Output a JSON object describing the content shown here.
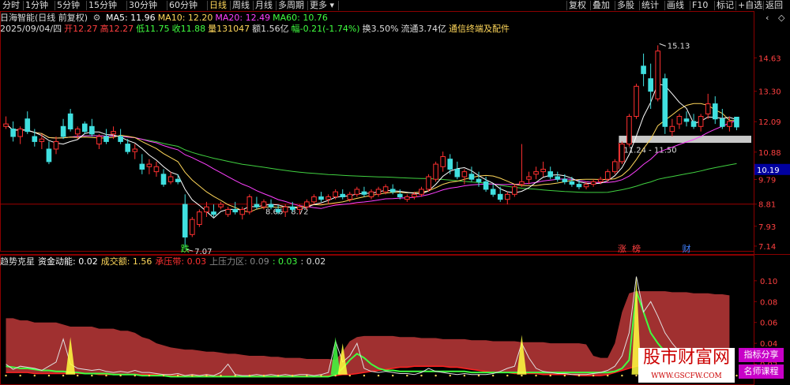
{
  "toolbar": {
    "items": [
      "分时",
      "1分钟",
      "5分钟",
      "15分钟",
      "30分钟",
      "60分钟",
      "日线",
      "周线",
      "月线",
      "多周期",
      "更多"
    ],
    "active": "日线",
    "right_items": [
      "复权",
      "叠加",
      "多股",
      "统计",
      "画线",
      "F10",
      "标记",
      "+自选",
      "返回"
    ],
    "window_icons": [
      "‹",
      "◇"
    ]
  },
  "header": {
    "title": "日海智能(日线 前复权)",
    "ma": [
      {
        "label": "MA5: 11.96",
        "color": "#ffffff"
      },
      {
        "label": "MA10: 12.20",
        "color": "#ffd75a"
      },
      {
        "label": "MA20: 12.49",
        "color": "#ff40ff"
      },
      {
        "label": "MA60: 10.76",
        "color": "#40ff40"
      }
    ],
    "quote": [
      {
        "label": "2025/09/04/四",
        "color": "#dddddd"
      },
      {
        "label": "开12.27",
        "color": "#ff4040"
      },
      {
        "label": "高12.27",
        "color": "#ff4040"
      },
      {
        "label": "低11.75",
        "color": "#40ff40"
      },
      {
        "label": "收11.88",
        "color": "#40ff40"
      },
      {
        "label": "量131047",
        "color": "#ffd75a"
      },
      {
        "label": "额1.56亿",
        "color": "#dddddd"
      },
      {
        "label": "幅-0.21(-1.74%)",
        "color": "#40ff40"
      },
      {
        "label": "换3.50%",
        "color": "#dddddd"
      },
      {
        "label": "流通3.74亿",
        "color": "#dddddd"
      },
      {
        "label": "通信终端及配件",
        "color": "#ffd75a"
      }
    ]
  },
  "sub_header": [
    {
      "label": "趋势克星",
      "color": "#dddddd"
    },
    {
      "label": "资金动能: 0.02",
      "color": "#ffffff"
    },
    {
      "label": "成交额: 1.56",
      "color": "#ffd75a"
    },
    {
      "label": "承压带: 0.03",
      "color": "#ff3030"
    },
    {
      "label": "上压力区: 0.09",
      "color": "#888888"
    },
    {
      "label": ": 0.03",
      "color": "#40ff40"
    },
    {
      "label": ": 0.02",
      "color": "#dddddd"
    }
  ],
  "chart_data": {
    "type": "candlestick",
    "y_axis_ticks": [
      14.63,
      13.3,
      12.09,
      10.88,
      9.79,
      8.81,
      7.93,
      7.14
    ],
    "ylim": [
      6.95,
      15.55
    ],
    "current_price_label": "10.19",
    "current_price": 10.19,
    "annotations": [
      {
        "text": "15.13",
        "kind": "high"
      },
      {
        "text": "7.07",
        "kind": "low"
      },
      {
        "text": "11.24 - 11.50",
        "kind": "zone",
        "y1": 11.24,
        "y2": 11.5
      },
      {
        "text": "8.66 - 8.72",
        "kind": "zone",
        "y1": 8.66,
        "y2": 8.72
      }
    ],
    "markers": [
      {
        "text": "跌",
        "color": "#40ff40",
        "index": 25
      },
      {
        "text": "涨",
        "color": "#ff4040",
        "index": 86
      },
      {
        "text": "榜",
        "color": "#ff4040",
        "index": 88
      },
      {
        "text": "财",
        "color": "#4080ff",
        "index": 95
      }
    ],
    "candles": [
      [
        11.9,
        12.3,
        11.8,
        12.0
      ],
      [
        11.8,
        12.1,
        11.3,
        11.5
      ],
      [
        11.5,
        11.9,
        11.2,
        11.8
      ],
      [
        12.2,
        12.5,
        11.6,
        11.7
      ],
      [
        11.5,
        11.8,
        11.1,
        11.3
      ],
      [
        11.3,
        11.6,
        11.0,
        11.4
      ],
      [
        11.0,
        11.3,
        10.4,
        10.5
      ],
      [
        11.0,
        11.5,
        10.8,
        11.3
      ],
      [
        11.9,
        12.2,
        11.4,
        11.5
      ],
      [
        12.4,
        12.6,
        11.7,
        11.8
      ],
      [
        11.6,
        11.9,
        11.4,
        11.8
      ],
      [
        12.0,
        12.1,
        11.6,
        11.7
      ],
      [
        11.9,
        12.2,
        11.5,
        11.6
      ],
      [
        11.2,
        11.6,
        11.0,
        11.5
      ],
      [
        11.5,
        11.8,
        11.2,
        11.3
      ],
      [
        11.6,
        11.9,
        11.4,
        11.7
      ],
      [
        11.5,
        11.8,
        11.2,
        11.3
      ],
      [
        11.2,
        11.4,
        10.8,
        10.9
      ],
      [
        10.9,
        11.2,
        10.6,
        11.0
      ],
      [
        10.4,
        10.8,
        10.0,
        10.2
      ],
      [
        10.3,
        10.6,
        10.0,
        10.4
      ],
      [
        10.1,
        10.5,
        9.9,
        10.3
      ],
      [
        10.0,
        10.2,
        9.5,
        9.6
      ],
      [
        9.7,
        10.1,
        9.6,
        9.9
      ],
      [
        9.8,
        10.0,
        9.6,
        9.7
      ],
      [
        8.8,
        9.2,
        7.07,
        7.5
      ],
      [
        7.6,
        8.3,
        7.5,
        8.2
      ],
      [
        8.0,
        8.6,
        7.9,
        8.5
      ],
      [
        8.5,
        8.9,
        8.3,
        8.7
      ],
      [
        8.5,
        8.8,
        8.3,
        8.4
      ],
      [
        8.7,
        8.9,
        8.6,
        8.8
      ],
      [
        8.4,
        8.7,
        8.3,
        8.6
      ],
      [
        8.6,
        8.9,
        8.4,
        8.5
      ],
      [
        8.4,
        8.7,
        8.2,
        8.6
      ],
      [
        8.5,
        9.2,
        8.4,
        9.1
      ],
      [
        8.8,
        9.1,
        8.6,
        8.7
      ],
      [
        8.7,
        9.0,
        8.6,
        8.9
      ],
      [
        8.8,
        9.0,
        8.6,
        8.7
      ],
      [
        8.6,
        8.8,
        8.4,
        8.5
      ],
      [
        8.5,
        8.8,
        8.3,
        8.7
      ],
      [
        8.7,
        8.9,
        8.5,
        8.6
      ],
      [
        8.6,
        8.8,
        8.4,
        8.7
      ],
      [
        8.7,
        9.0,
        8.6,
        8.9
      ],
      [
        8.9,
        9.2,
        8.8,
        9.1
      ],
      [
        9.1,
        9.3,
        8.9,
        9.0
      ],
      [
        9.0,
        9.2,
        8.8,
        9.1
      ],
      [
        9.1,
        9.4,
        9.0,
        9.3
      ],
      [
        9.2,
        9.4,
        9.0,
        9.1
      ],
      [
        9.0,
        9.3,
        8.9,
        9.2
      ],
      [
        9.2,
        9.5,
        9.1,
        9.4
      ],
      [
        9.3,
        9.5,
        9.1,
        9.2
      ],
      [
        9.1,
        9.4,
        9.0,
        9.3
      ],
      [
        9.2,
        9.5,
        9.1,
        9.4
      ],
      [
        9.3,
        9.6,
        9.2,
        9.5
      ],
      [
        9.4,
        9.6,
        9.2,
        9.3
      ],
      [
        9.2,
        9.4,
        9.0,
        9.1
      ],
      [
        9.0,
        9.2,
        8.9,
        9.1
      ],
      [
        9.1,
        9.3,
        9.0,
        9.2
      ],
      [
        9.2,
        9.5,
        9.1,
        9.4
      ],
      [
        9.4,
        10.0,
        9.3,
        9.9
      ],
      [
        9.8,
        10.5,
        9.7,
        10.4
      ],
      [
        10.3,
        10.9,
        10.1,
        10.7
      ],
      [
        10.6,
        10.8,
        10.0,
        10.2
      ],
      [
        10.2,
        10.5,
        9.8,
        9.9
      ],
      [
        9.9,
        10.2,
        9.6,
        10.1
      ],
      [
        10.0,
        10.3,
        9.7,
        9.8
      ],
      [
        9.8,
        10.1,
        9.5,
        9.7
      ],
      [
        9.7,
        9.9,
        9.3,
        9.4
      ],
      [
        9.4,
        9.6,
        9.1,
        9.2
      ],
      [
        9.2,
        9.5,
        8.9,
        9.0
      ],
      [
        9.0,
        9.3,
        8.8,
        9.2
      ],
      [
        9.2,
        9.6,
        9.1,
        9.5
      ],
      [
        9.6,
        11.2,
        9.5,
        9.7
      ],
      [
        9.8,
        10.1,
        9.6,
        9.9
      ],
      [
        10.0,
        10.3,
        9.8,
        10.1
      ],
      [
        10.1,
        10.5,
        9.9,
        10.2
      ],
      [
        10.1,
        10.3,
        9.8,
        9.9
      ],
      [
        9.9,
        10.1,
        9.7,
        9.8
      ],
      [
        9.8,
        10.0,
        9.6,
        9.7
      ],
      [
        9.7,
        9.9,
        9.5,
        9.6
      ],
      [
        9.6,
        9.8,
        9.4,
        9.5
      ],
      [
        9.5,
        9.7,
        9.4,
        9.6
      ],
      [
        9.6,
        9.8,
        9.5,
        9.7
      ],
      [
        9.7,
        9.9,
        9.6,
        9.8
      ],
      [
        9.8,
        10.2,
        9.7,
        10.1
      ],
      [
        10.1,
        10.6,
        10.0,
        10.5
      ],
      [
        10.5,
        11.3,
        10.4,
        11.2
      ],
      [
        11.2,
        12.4,
        11.1,
        12.3
      ],
      [
        12.3,
        13.6,
        12.2,
        13.5
      ],
      [
        14.3,
        14.8,
        13.5,
        14.0
      ],
      [
        13.8,
        14.4,
        12.6,
        13.3
      ],
      [
        13.0,
        15.13,
        12.9,
        14.9
      ],
      [
        13.8,
        14.0,
        11.6,
        11.9
      ],
      [
        11.7,
        12.2,
        11.5,
        11.9
      ],
      [
        12.0,
        12.4,
        11.8,
        12.3
      ],
      [
        12.2,
        12.5,
        11.9,
        12.1
      ],
      [
        12.1,
        12.4,
        11.8,
        11.9
      ],
      [
        11.9,
        12.4,
        11.7,
        12.3
      ],
      [
        12.4,
        13.2,
        12.2,
        12.8
      ],
      [
        12.8,
        13.1,
        12.0,
        12.2
      ],
      [
        12.2,
        12.6,
        11.8,
        11.9
      ],
      [
        11.9,
        12.3,
        11.7,
        12.1
      ],
      [
        12.27,
        12.27,
        11.75,
        11.88
      ]
    ],
    "sub_ticks": [
      0.1,
      0.08,
      0.06,
      0.04,
      0.02
    ],
    "sub_ylim": [
      0.0,
      0.112
    ],
    "sub_pressure_zone": [
      0.064,
      0.064,
      0.062,
      0.062,
      0.06,
      0.06,
      0.06,
      0.06,
      0.058,
      0.056,
      0.056,
      0.056,
      0.056,
      0.054,
      0.054,
      0.054,
      0.052,
      0.052,
      0.05,
      0.046,
      0.044,
      0.04,
      0.038,
      0.036,
      0.035,
      0.034,
      0.034,
      0.033,
      0.032,
      0.032,
      0.031,
      0.03,
      0.03,
      0.029,
      0.028,
      0.028,
      0.028,
      0.027,
      0.027,
      0.026,
      0.026,
      0.026,
      0.025,
      0.025,
      0.025,
      0.025,
      0.024,
      0.032,
      0.042,
      0.046,
      0.047,
      0.047,
      0.047,
      0.047,
      0.047,
      0.046,
      0.046,
      0.046,
      0.045,
      0.045,
      0.045,
      0.044,
      0.044,
      0.044,
      0.044,
      0.043,
      0.043,
      0.043,
      0.042,
      0.042,
      0.042,
      0.042,
      0.041,
      0.041,
      0.041,
      0.041,
      0.04,
      0.04,
      0.04,
      0.04,
      0.04,
      0.039,
      0.028,
      0.026,
      0.026,
      0.04,
      0.07,
      0.088,
      0.09,
      0.09,
      0.09,
      0.09,
      0.09,
      0.089,
      0.089,
      0.089,
      0.088,
      0.088,
      0.088,
      0.087,
      0.087,
      0.086
    ],
    "sub_pressure_base": [
      0.012,
      0.012,
      0.012,
      0.012,
      0.011,
      0.011,
      0.011,
      0.011,
      0.011,
      0.011,
      0.011,
      0.011,
      0.011,
      0.01,
      0.01,
      0.01,
      0.01,
      0.01,
      0.01,
      0.01,
      0.01,
      0.01,
      0.01,
      0.009,
      0.009,
      0.009,
      0.009,
      0.009,
      0.009,
      0.009,
      0.008,
      0.008,
      0.008,
      0.008,
      0.008,
      0.008,
      0.008,
      0.008,
      0.008,
      0.008,
      0.008,
      0.008,
      0.008,
      0.008,
      0.008,
      0.009,
      0.009,
      0.01,
      0.01,
      0.011,
      0.012,
      0.013,
      0.014,
      0.015,
      0.016,
      0.017,
      0.017,
      0.018,
      0.018,
      0.018,
      0.018,
      0.018,
      0.017,
      0.017,
      0.016,
      0.015,
      0.014,
      0.013,
      0.012,
      0.012,
      0.012,
      0.011,
      0.011,
      0.011,
      0.011,
      0.01,
      0.01,
      0.01,
      0.01,
      0.01,
      0.009,
      0.009,
      0.009,
      0.009,
      0.01,
      0.012,
      0.014,
      0.016,
      0.018,
      0.019,
      0.02,
      0.02,
      0.02,
      0.02,
      0.02,
      0.02,
      0.02,
      0.02,
      0.02,
      0.02,
      0.02,
      0.02
    ],
    "sub_white": [
      0.02,
      0.015,
      0.018,
      0.017,
      0.016,
      0.014,
      0.018,
      0.022,
      0.044,
      0.02,
      0.016,
      0.015,
      0.014,
      0.015,
      0.013,
      0.012,
      0.013,
      0.012,
      0.014,
      0.012,
      0.012,
      0.011,
      0.01,
      0.01,
      0.011,
      0.009,
      0.01,
      0.009,
      0.01,
      0.009,
      0.012,
      0.02,
      0.01,
      0.009,
      0.009,
      0.01,
      0.009,
      0.01,
      0.009,
      0.01,
      0.009,
      0.01,
      0.01,
      0.009,
      0.01,
      0.012,
      0.042,
      0.022,
      0.028,
      0.04,
      0.016,
      0.013,
      0.012,
      0.013,
      0.012,
      0.011,
      0.011,
      0.01,
      0.012,
      0.016,
      0.013,
      0.012,
      0.011,
      0.01,
      0.011,
      0.01,
      0.01,
      0.01,
      0.011,
      0.013,
      0.016,
      0.018,
      0.04,
      0.026,
      0.016,
      0.013,
      0.012,
      0.011,
      0.011,
      0.01,
      0.01,
      0.01,
      0.011,
      0.012,
      0.014,
      0.018,
      0.028,
      0.05,
      0.104,
      0.07,
      0.08,
      0.066,
      0.05,
      0.04,
      0.032,
      0.026,
      0.02,
      0.018,
      0.016,
      0.015,
      0.014,
      0.014
    ],
    "sub_green": [
      0.018,
      0.017,
      0.016,
      0.016,
      0.015,
      0.014,
      0.014,
      0.013,
      0.013,
      0.012,
      0.012,
      0.011,
      0.011,
      0.011,
      0.011,
      0.01,
      0.01,
      0.01,
      0.01,
      0.009,
      0.009,
      0.009,
      0.009,
      0.008,
      0.008,
      0.008,
      0.008,
      0.008,
      0.008,
      0.008,
      0.008,
      0.008,
      0.008,
      0.008,
      0.008,
      0.008,
      0.008,
      0.008,
      0.008,
      0.008,
      0.008,
      0.008,
      0.008,
      0.008,
      0.008,
      0.008,
      0.01,
      0.016,
      0.024,
      0.03,
      0.026,
      0.02,
      0.016,
      0.014,
      0.014,
      0.013,
      0.013,
      0.013,
      0.013,
      0.013,
      0.013,
      0.013,
      0.013,
      0.013,
      0.013,
      0.012,
      0.012,
      0.012,
      0.012,
      0.012,
      0.012,
      0.012,
      0.012,
      0.012,
      0.012,
      0.012,
      0.012,
      0.012,
      0.012,
      0.012,
      0.012,
      0.012,
      0.012,
      0.012,
      0.012,
      0.013,
      0.016,
      0.024,
      0.09,
      0.07,
      0.05,
      0.04,
      0.032,
      0.028,
      0.026,
      0.024,
      0.022,
      0.022,
      0.022,
      0.022,
      0.022,
      0.022
    ],
    "sub_spikes": [
      {
        "index": 9,
        "value": 0.046,
        "color": "#ffff40"
      },
      {
        "index": 46,
        "value": 0.046,
        "color": "#40ff40"
      },
      {
        "index": 47,
        "value": 0.04,
        "color": "#ffff40"
      },
      {
        "index": 72,
        "value": 0.048,
        "color": "#ffff40"
      },
      {
        "index": 88,
        "value": 0.104,
        "color": "#ffff40"
      }
    ]
  },
  "watermark": {
    "title": "股市财富网",
    "url": "WWW.GSCFW.COM",
    "tag1": "指标分享",
    "tag2": "名师课程"
  }
}
